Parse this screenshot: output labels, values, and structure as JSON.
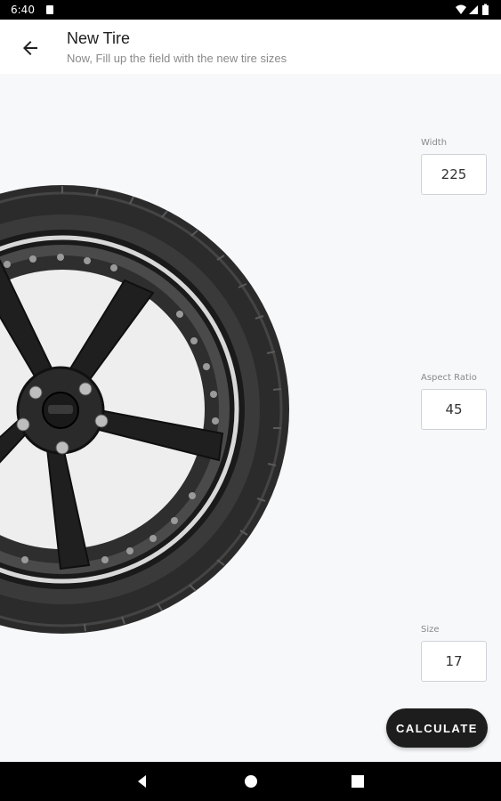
{
  "status_bar": {
    "time": "6:40",
    "icons": [
      "sd-card-icon",
      "wifi-icon",
      "signal-icon",
      "battery-icon"
    ]
  },
  "app_bar": {
    "title": "New Tire",
    "subtitle": "Now, Fill up the field with the new tire sizes",
    "back_icon": "arrow-back-icon"
  },
  "form": {
    "width": {
      "label": "Width",
      "value": "225"
    },
    "aspect_ratio": {
      "label": "Aspect Ratio",
      "value": "45"
    },
    "size": {
      "label": "Size",
      "value": "17"
    }
  },
  "actions": {
    "calculate_label": "CALCULATE"
  },
  "nav_bar": {
    "icons": [
      "back-triangle-icon",
      "home-circle-icon",
      "recents-square-icon"
    ]
  },
  "colors": {
    "background": "#f7f8fa",
    "app_bar": "#ffffff",
    "button": "#1d1d1d",
    "status_bar": "#000000"
  }
}
